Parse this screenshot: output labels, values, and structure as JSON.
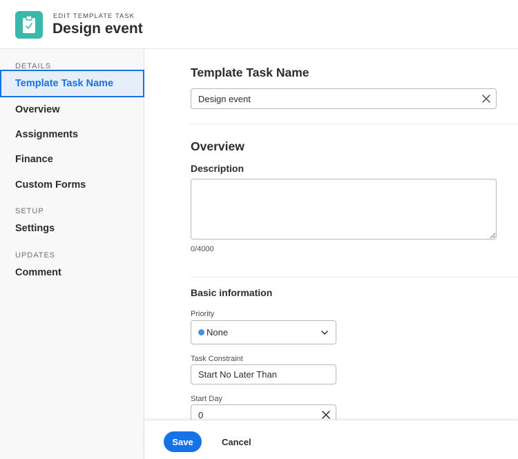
{
  "header": {
    "eyebrow": "EDIT TEMPLATE TASK",
    "title": "Design event",
    "icon": "clipboard-check-icon",
    "icon_color": "#3bb8ac"
  },
  "sidebar": {
    "sections": [
      {
        "label": "DETAILS",
        "items": [
          "Template Task Name",
          "Overview",
          "Assignments",
          "Finance",
          "Custom Forms"
        ]
      },
      {
        "label": "SETUP",
        "items": [
          "Settings"
        ]
      },
      {
        "label": "UPDATES",
        "items": [
          "Comment"
        ]
      }
    ],
    "active_item": "Template Task Name"
  },
  "main": {
    "name_section": {
      "heading": "Template Task Name",
      "value": "Design event"
    },
    "overview": {
      "heading": "Overview",
      "description_label": "Description",
      "description_value": "",
      "counter": "0/4000"
    },
    "basic_info": {
      "heading": "Basic information",
      "priority_label": "Priority",
      "priority_value": "None",
      "priority_dot_color": "#4a8fe3",
      "constraint_label": "Task Constraint",
      "constraint_value": "Start No Later Than",
      "start_day_label": "Start Day",
      "start_day_value": "0"
    }
  },
  "footer": {
    "save_label": "Save",
    "cancel_label": "Cancel"
  },
  "colors": {
    "accent": "#1473e6",
    "active_bg": "#e5eef9"
  }
}
